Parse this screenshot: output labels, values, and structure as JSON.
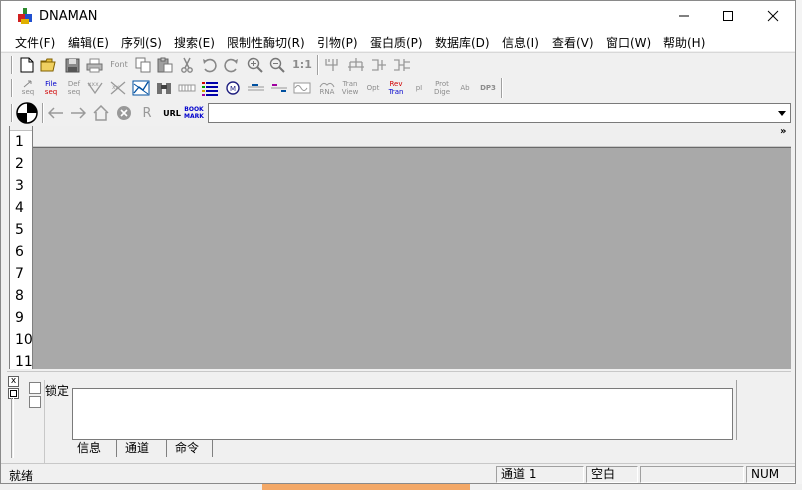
{
  "window": {
    "title": "DNAMAN"
  },
  "menu": [
    "文件(F)",
    "编辑(E)",
    "序列(S)",
    "搜索(E)",
    "限制性酶切(R)",
    "引物(P)",
    "蛋白质(P)",
    "数据库(D)",
    "信息(I)",
    "查看(V)",
    "窗口(W)",
    "帮助(H)"
  ],
  "toolbar1": {
    "font_label": "Font",
    "ratio_label": "1:1"
  },
  "toolbar2": {
    "labels": [
      {
        "top": "",
        "bottom": "seq"
      },
      {
        "top": "File",
        "bottom": "seq"
      },
      {
        "top": "Def",
        "bottom": "seq"
      },
      {
        "top": "",
        "bottom": "RNA"
      },
      {
        "top": "Tran",
        "bottom": "View"
      },
      {
        "top": "Opt",
        "bottom": ""
      },
      {
        "top": "Rev",
        "bottom": "Tran"
      },
      {
        "top": "pI",
        "bottom": ""
      },
      {
        "top": "Prot",
        "bottom": "Dige"
      },
      {
        "top": "Ab",
        "bottom": ""
      },
      {
        "top": "DP3",
        "bottom": ""
      }
    ]
  },
  "toolbar3": {
    "r_label": "R",
    "url_label": "URL",
    "bookmark_top": "BOOK",
    "bookmark_bottom": "MARK",
    "address_value": ""
  },
  "editor": {
    "ruler_more": "»",
    "line_numbers": [
      "1",
      "2",
      "3",
      "4",
      "5",
      "6",
      "7",
      "8",
      "9",
      "10",
      "11"
    ]
  },
  "panel": {
    "lock_label": "锁定",
    "tabs": [
      "信息",
      "通道",
      "命令"
    ],
    "close_glyph": "x",
    "output_text": ""
  },
  "status": {
    "ready": "就绪",
    "channel": "通道 1",
    "blank": "空白",
    "num": "NUM"
  },
  "colors": {
    "editor_bg": "#a9a9a9",
    "accent_red": "#d00000",
    "accent_blue": "#0000cc"
  }
}
